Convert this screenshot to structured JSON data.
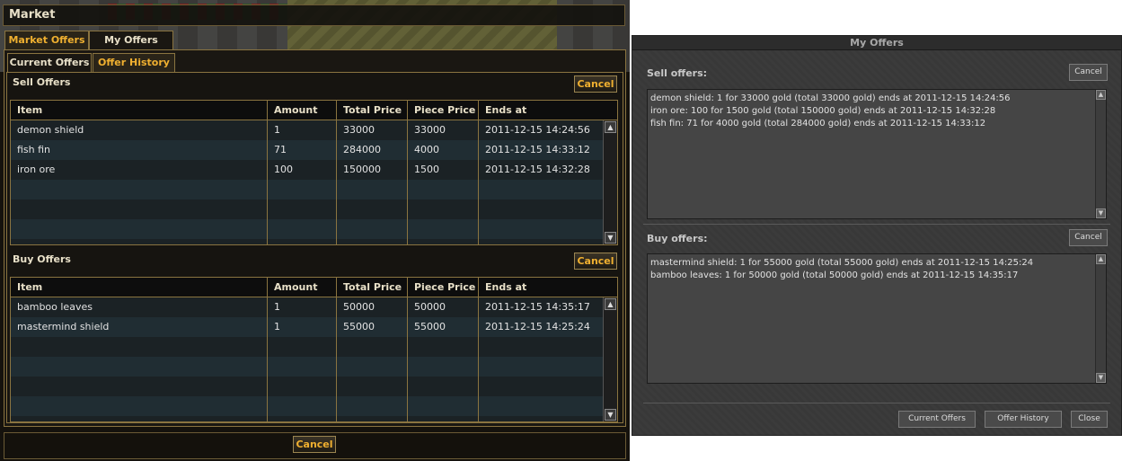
{
  "market": {
    "title": "Market",
    "tabs": {
      "market_offers": "Market Offers",
      "my_offers": "My Offers"
    },
    "subtabs": {
      "current_offers": "Current Offers",
      "offer_history": "Offer History"
    },
    "sell_label": "Sell Offers",
    "buy_label": "Buy Offers",
    "cancel": "Cancel",
    "columns": [
      "Item",
      "Amount",
      "Total Price",
      "Piece Price",
      "Ends at"
    ],
    "sell_rows": [
      [
        "demon shield",
        "1",
        "33000",
        "33000",
        "2011-12-15 14:24:56"
      ],
      [
        "fish fin",
        "71",
        "284000",
        "4000",
        "2011-12-15 14:33:12"
      ],
      [
        "iron ore",
        "100",
        "150000",
        "1500",
        "2011-12-15 14:32:28"
      ]
    ],
    "buy_rows": [
      [
        "bamboo leaves",
        "1",
        "50000",
        "50000",
        "2011-12-15 14:35:17"
      ],
      [
        "mastermind shield",
        "1",
        "55000",
        "55000",
        "2011-12-15 14:25:24"
      ]
    ],
    "bottom_cancel": "Cancel"
  },
  "myoffers": {
    "title": "My Offers",
    "sell_label": "Sell offers:",
    "buy_label": "Buy offers:",
    "cancel": "Cancel",
    "sell_lines": [
      "demon shield: 1 for 33000 gold (total 33000 gold) ends at 2011-12-15 14:24:56",
      "iron ore: 100 for 1500 gold (total 150000 gold) ends at 2011-12-15 14:32:28",
      "fish fin: 71 for 4000 gold (total 284000 gold) ends at 2011-12-15 14:33:12"
    ],
    "buy_lines": [
      "mastermind shield: 1 for 55000 gold (total 55000 gold) ends at 2011-12-15 14:25:24",
      "bamboo leaves: 1 for 50000 gold (total 50000 gold) ends at 2011-12-15 14:35:17"
    ],
    "buttons": {
      "current_offers": "Current Offers",
      "offer_history": "Offer History",
      "close": "Close"
    }
  }
}
